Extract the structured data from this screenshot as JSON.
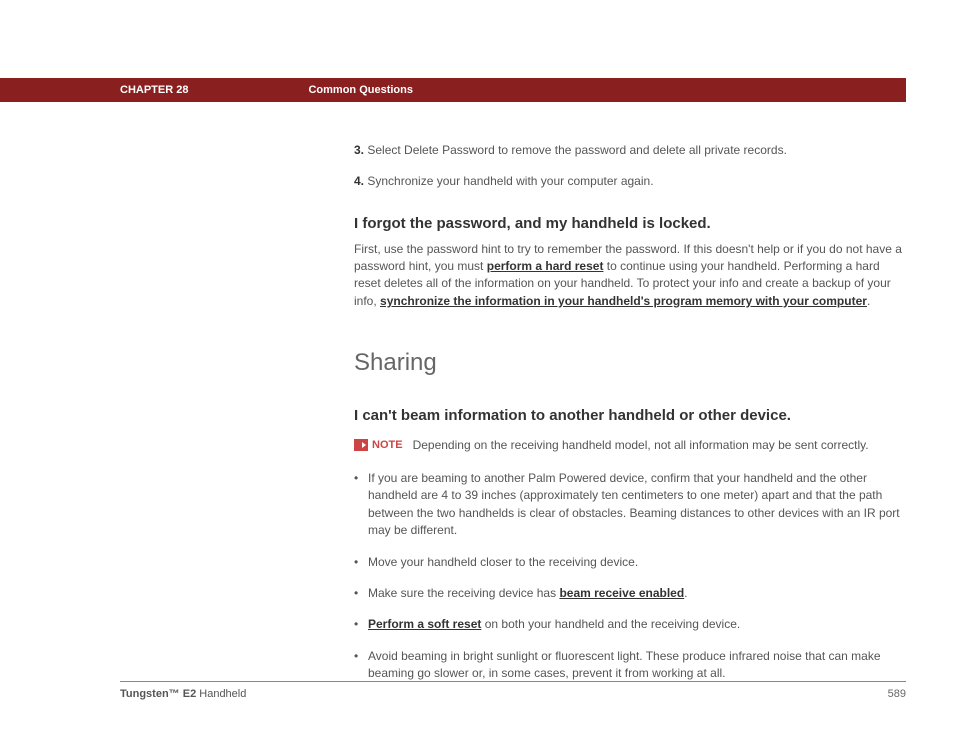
{
  "header": {
    "chapter": "CHAPTER 28",
    "section": "Common Questions"
  },
  "steps": [
    {
      "num": "3.",
      "text": "Select Delete Password to remove the password and delete all private records."
    },
    {
      "num": "4.",
      "text": "Synchronize your handheld with your computer again."
    }
  ],
  "sub1": {
    "heading": "I forgot the password, and my handheld is locked.",
    "para_parts": {
      "t1": "First, use the password hint to try to remember the password. If this doesn't help or if you do not have a password hint, you must ",
      "link1": "perform a hard reset",
      "t2": " to continue using your handheld. Performing a hard reset deletes all of the information on your handheld. To protect your info and create a backup of your info, ",
      "link2": "synchronize the information in your handheld's program memory with your computer",
      "t3": "."
    }
  },
  "section_heading": "Sharing",
  "sub2": {
    "heading": "I can't beam information to another handheld or other device.",
    "note_label": "NOTE",
    "note_text": "Depending on the receiving handheld model, not all information may be sent correctly.",
    "bullets": {
      "b1": "If you are beaming to another Palm Powered device, confirm that your handheld and the other handheld are 4 to 39 inches (approximately ten centimeters to one meter) apart and that the path between the two handhelds is clear of obstacles. Beaming distances to other devices with an IR port may be different.",
      "b2": "Move your handheld closer to the receiving device.",
      "b3_pre": "Make sure the receiving device has ",
      "b3_link": "beam receive enabled",
      "b3_post": ".",
      "b4_link": "Perform a soft reset",
      "b4_post": " on both your handheld and the receiving device.",
      "b5": "Avoid beaming in bright sunlight or fluorescent light. These produce infrared noise that can make beaming go slower or, in some cases, prevent it from working at all."
    }
  },
  "footer": {
    "product_bold": "Tungsten™ E2",
    "product_rest": " Handheld",
    "page": "589"
  }
}
